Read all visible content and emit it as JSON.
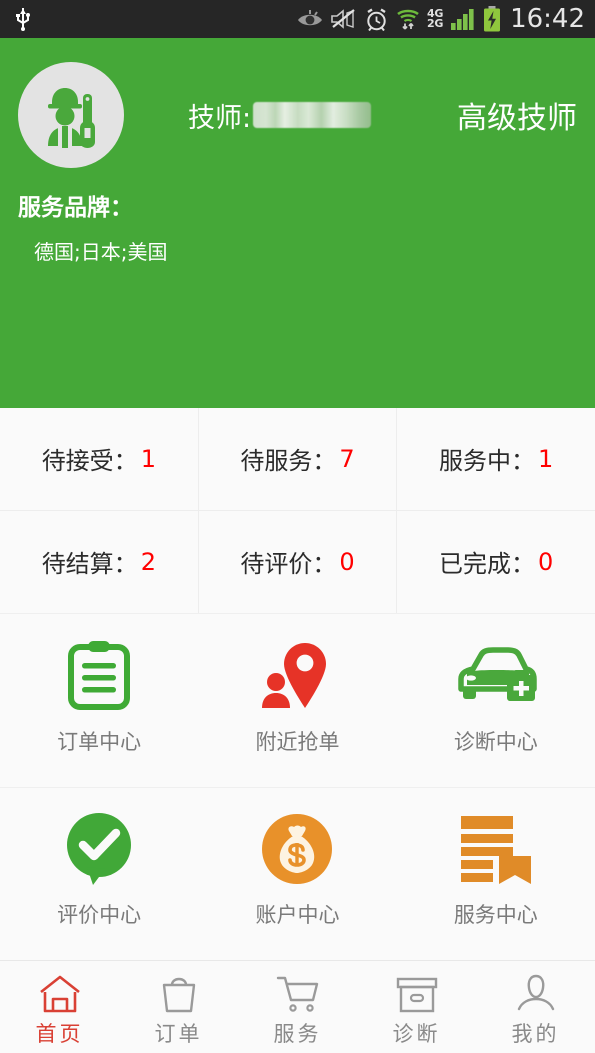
{
  "statusbar": {
    "time": "16:42",
    "network_primary": "4G",
    "network_secondary": "2G",
    "icons": [
      "usb-icon",
      "eye-icon",
      "mute-icon",
      "alarm-icon",
      "wifi-icon",
      "signal-icon",
      "battery-charging-icon"
    ]
  },
  "header": {
    "avatar_icon": "technician-avatar-icon",
    "technician_label": "技师:",
    "technician_name_redacted": "",
    "level": "高级技师",
    "brand_label": "服务品牌：",
    "brand_value": "德国;日本;美国",
    "background_color": "#45a838"
  },
  "stats": {
    "number_color": "#ff0000",
    "items": [
      {
        "label": "待接受：",
        "value": "1"
      },
      {
        "label": "待服务：",
        "value": "7"
      },
      {
        "label": "服务中：",
        "value": "1"
      },
      {
        "label": "待结算：",
        "value": "2"
      },
      {
        "label": "待评价：",
        "value": "0"
      },
      {
        "label": "已完成：",
        "value": "0"
      }
    ]
  },
  "grid": {
    "items": [
      {
        "label": "订单中心",
        "icon": "clipboard-icon",
        "color": "#3faa35"
      },
      {
        "label": "附近抢单",
        "icon": "map-pin-person-icon",
        "color": "#e63327"
      },
      {
        "label": "诊断中心",
        "icon": "car-medical-icon",
        "color": "#4aa83c"
      },
      {
        "label": "评价中心",
        "icon": "check-bubble-icon",
        "color": "#41a838"
      },
      {
        "label": "账户中心",
        "icon": "money-bag-icon",
        "color": "#e8912a"
      },
      {
        "label": "服务中心",
        "icon": "list-bookmark-icon",
        "color": "#e08b28"
      }
    ]
  },
  "tabbar": {
    "active_color": "#d94034",
    "inactive_color": "#8a8a8a",
    "items": [
      {
        "label": "首页",
        "icon": "home-icon",
        "active": true
      },
      {
        "label": "订单",
        "icon": "shopping-bag-icon",
        "active": false
      },
      {
        "label": "服务",
        "icon": "cart-icon",
        "active": false
      },
      {
        "label": "诊断",
        "icon": "box-icon",
        "active": false
      },
      {
        "label": "我的",
        "icon": "person-icon",
        "active": false
      }
    ]
  }
}
